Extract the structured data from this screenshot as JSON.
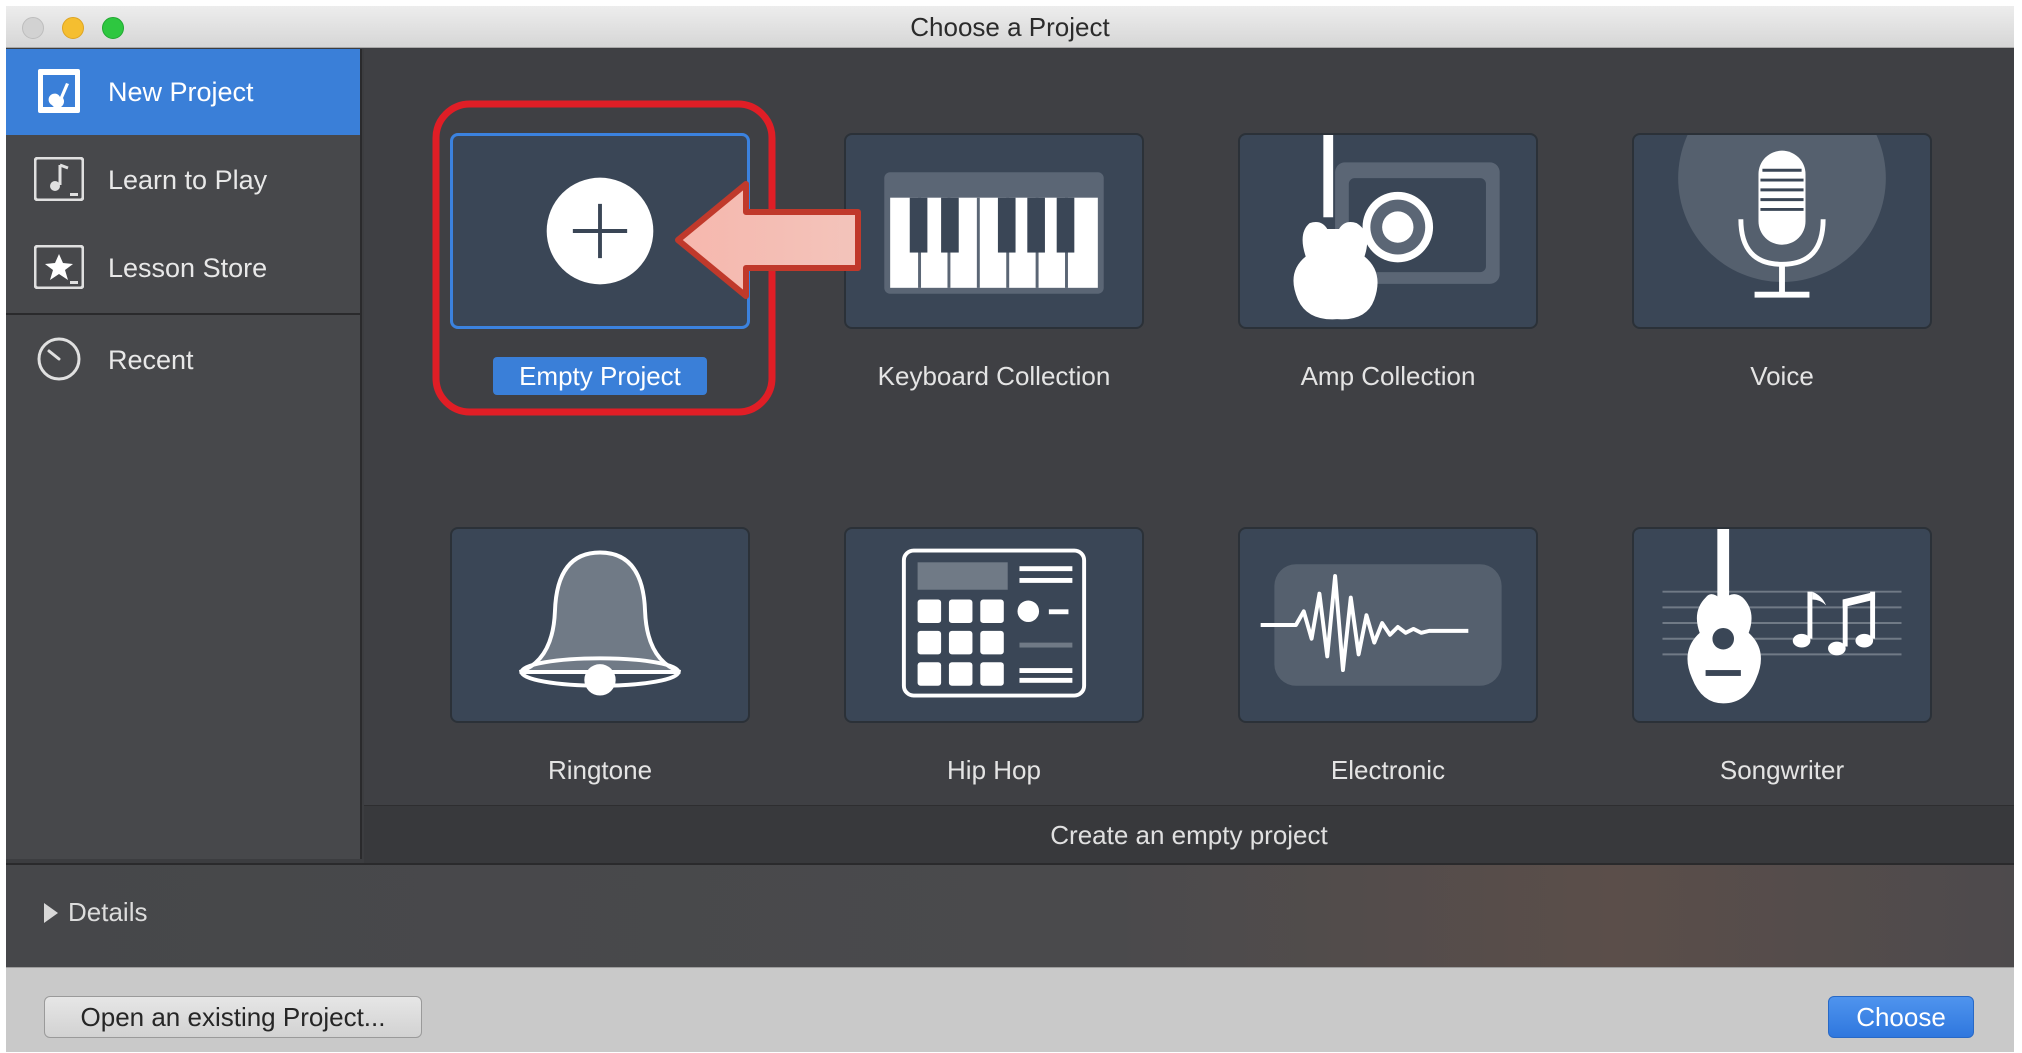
{
  "window": {
    "title": "Choose a Project"
  },
  "sidebar": {
    "items": [
      {
        "label": "New Project",
        "icon": "new-project-icon",
        "selected": true
      },
      {
        "label": "Learn to Play",
        "icon": "music-note-icon",
        "selected": false
      },
      {
        "label": "Lesson Store",
        "icon": "star-icon",
        "selected": false
      },
      {
        "label": "Recent",
        "icon": "clock-icon",
        "selected": false
      }
    ]
  },
  "templates": [
    {
      "label": "Empty Project",
      "icon": "plus-icon",
      "selected": true
    },
    {
      "label": "Keyboard Collection",
      "icon": "keyboard-icon",
      "selected": false
    },
    {
      "label": "Amp Collection",
      "icon": "guitar-amp-icon",
      "selected": false
    },
    {
      "label": "Voice",
      "icon": "microphone-icon",
      "selected": false
    },
    {
      "label": "Ringtone",
      "icon": "bell-icon",
      "selected": false
    },
    {
      "label": "Hip Hop",
      "icon": "drum-machine-icon",
      "selected": false
    },
    {
      "label": "Electronic",
      "icon": "waveform-icon",
      "selected": false
    },
    {
      "label": "Songwriter",
      "icon": "acoustic-guitar-icon",
      "selected": false
    }
  ],
  "status": {
    "text": "Create an empty project"
  },
  "details": {
    "label": "Details"
  },
  "buttons": {
    "open_existing": "Open an existing Project...",
    "choose": "Choose"
  },
  "colors": {
    "accent": "#3a7fd8",
    "annotation": "#e01e26",
    "tile": "#3a4656"
  }
}
